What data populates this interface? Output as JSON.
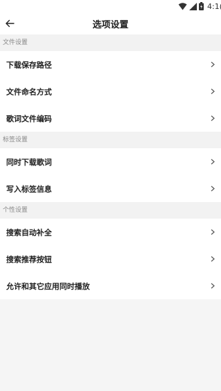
{
  "status_bar": {
    "time": "4:1(",
    "icons": [
      "wifi-icon",
      "signal-icon",
      "battery-icon"
    ]
  },
  "header": {
    "title": "选项设置",
    "back_icon": "arrow-left-icon"
  },
  "sections": [
    {
      "title": "文件设置",
      "items": [
        {
          "label": "下载保存路径"
        },
        {
          "label": "文件命名方式"
        },
        {
          "label": "歌词文件编码"
        }
      ]
    },
    {
      "title": "标签设置",
      "items": [
        {
          "label": "同时下载歌词"
        },
        {
          "label": "写入标签信息"
        }
      ]
    },
    {
      "title": "个性设置",
      "items": [
        {
          "label": "搜索自动补全"
        },
        {
          "label": "搜索推荐按钮"
        },
        {
          "label": "允许和其它应用同时播放"
        }
      ]
    }
  ],
  "colors": {
    "background": "#f5f5f5",
    "surface": "#ffffff",
    "section_text": "#888888",
    "text": "#222222"
  }
}
